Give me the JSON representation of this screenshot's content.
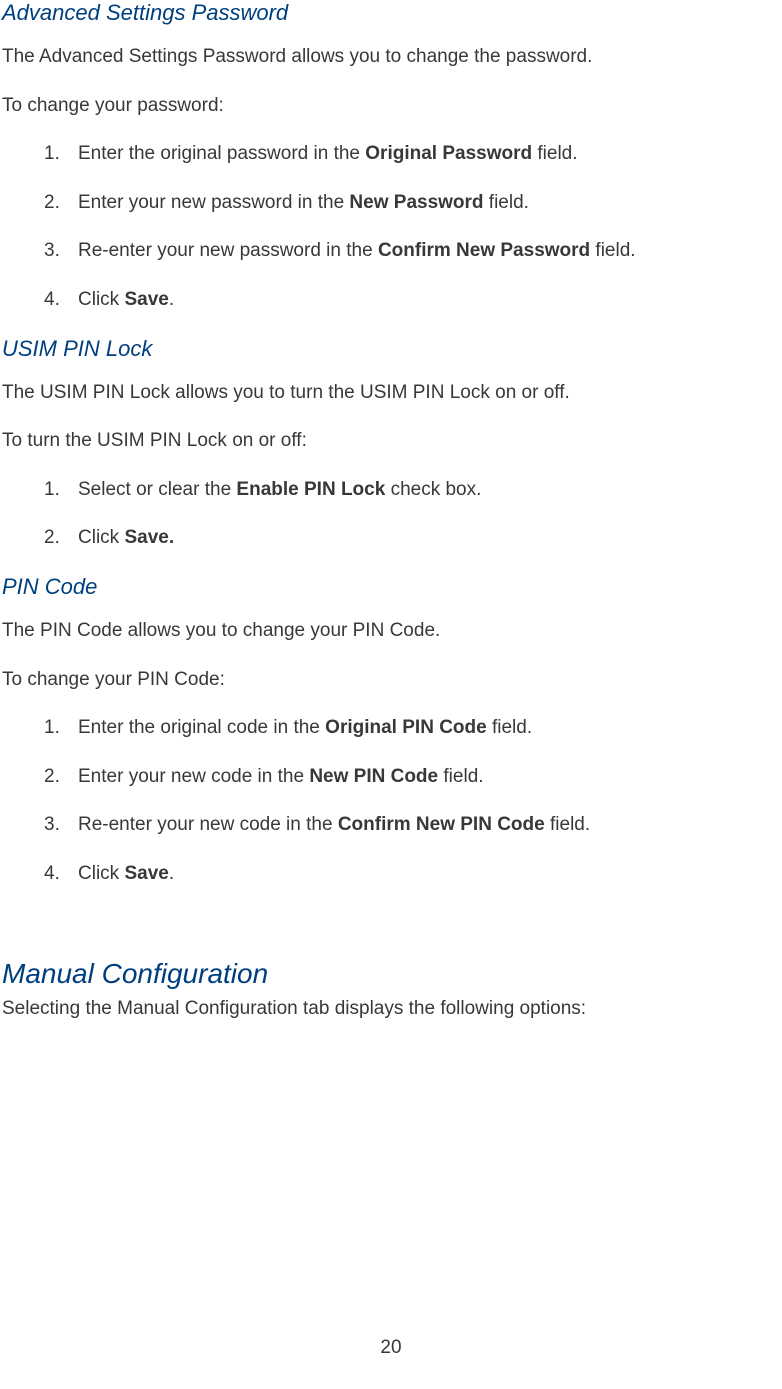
{
  "sections": {
    "advanced": {
      "heading": "Advanced Settings Password",
      "desc": "The Advanced Settings Password allows you to change the password.",
      "intro": "To change your password:",
      "steps": {
        "s1_pre": "Enter the original password in the ",
        "s1_bold": "Original Password",
        "s1_post": " field.",
        "s2_pre": "Enter your new password in the ",
        "s2_bold": "New Password",
        "s2_post": " field.",
        "s3_pre": "Re-enter your new password in the ",
        "s3_bold": "Confirm New Password",
        "s3_post": " field.",
        "s4_pre": "Click ",
        "s4_bold": "Save",
        "s4_post": "."
      }
    },
    "usim": {
      "heading": "USIM PIN Lock",
      "desc": "The USIM PIN Lock allows you to turn the USIM PIN Lock on or off.",
      "intro": "To turn the USIM PIN Lock on or off:",
      "steps": {
        "s1_pre": "Select or clear the ",
        "s1_bold": "Enable PIN Lock",
        "s1_post": " check box.",
        "s2_pre": "Click ",
        "s2_bold": "Save.",
        "s2_post": ""
      }
    },
    "pin": {
      "heading": "PIN Code",
      "desc": "The PIN Code allows you to change your PIN Code.",
      "intro": "To change your PIN Code:",
      "steps": {
        "s1_pre": "Enter the original code in the ",
        "s1_bold": "Original PIN Code",
        "s1_post": " field.",
        "s2_pre": "Enter your new code in the ",
        "s2_bold": "New PIN Code",
        "s2_post": " field.",
        "s3_pre": "Re-enter your new code in the ",
        "s3_bold": "Confirm New PIN Code",
        "s3_post": " field.",
        "s4_pre": "Click ",
        "s4_bold": "Save",
        "s4_post": "."
      }
    },
    "manual": {
      "heading": "Manual Configuration",
      "desc": "Selecting the Manual Configuration tab displays the following options:"
    }
  },
  "page_number": "20"
}
